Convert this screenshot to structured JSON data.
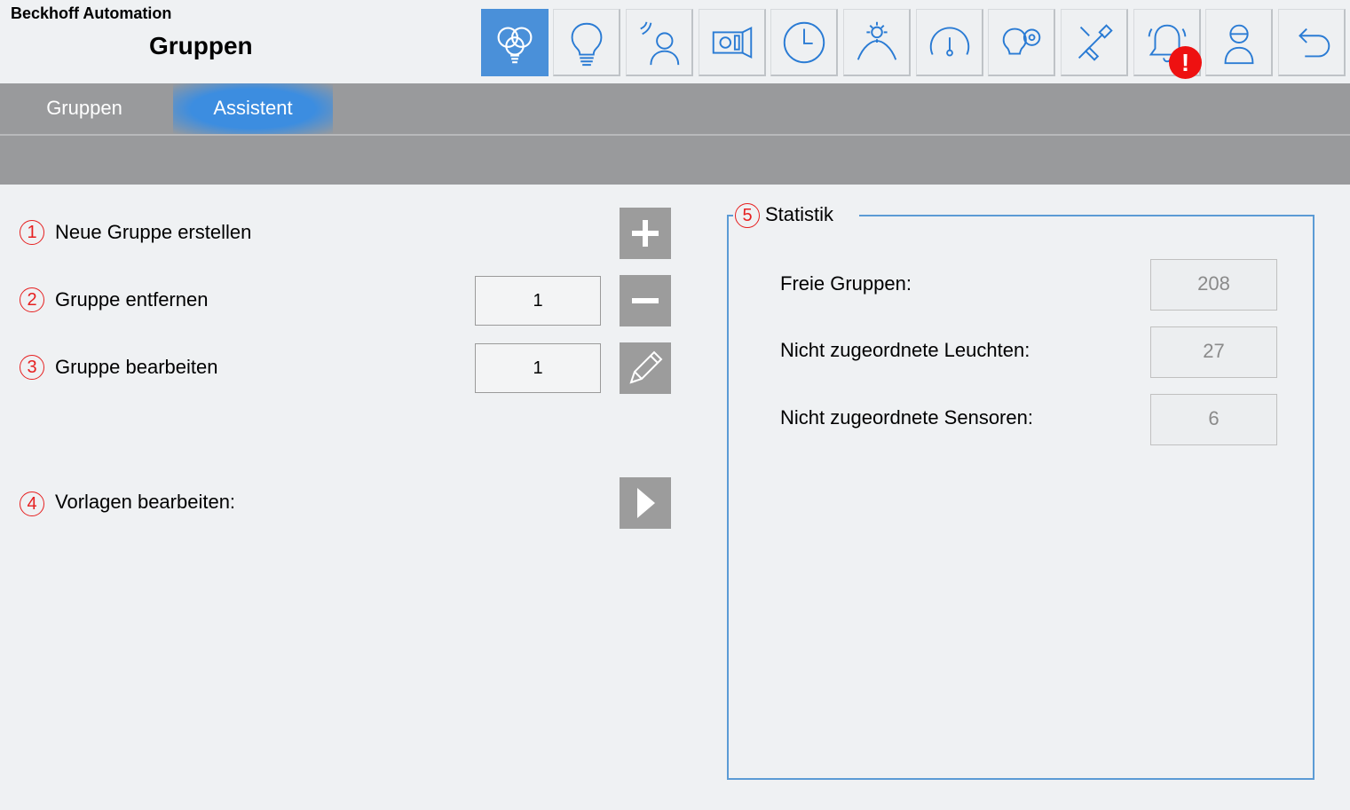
{
  "header": {
    "brand": "Beckhoff Automation",
    "title": "Gruppen"
  },
  "nav": {
    "buttons": [
      {
        "icon": "groups-icon",
        "active": true
      },
      {
        "icon": "bulb-icon"
      },
      {
        "icon": "sensor-person-icon"
      },
      {
        "icon": "device-icon"
      },
      {
        "icon": "clock-icon"
      },
      {
        "icon": "daylight-icon"
      },
      {
        "icon": "gauge-icon"
      },
      {
        "icon": "bulb-gear-icon"
      },
      {
        "icon": "tools-icon"
      },
      {
        "icon": "alarm-bell-icon",
        "badge": "!"
      },
      {
        "icon": "user-icon"
      },
      {
        "icon": "back-icon"
      }
    ],
    "alarm_badge": "!"
  },
  "tabs": [
    {
      "label": "Gruppen",
      "active": false
    },
    {
      "label": "Assistent",
      "active": true
    }
  ],
  "assistant": {
    "rows": [
      {
        "number": "1",
        "label": "Neue Gruppe erstellen",
        "button_icon": "plus-icon"
      },
      {
        "number": "2",
        "label": "Gruppe entfernen",
        "value": "1",
        "button_icon": "minus-icon"
      },
      {
        "number": "3",
        "label": "Gruppe bearbeiten",
        "value": "1",
        "button_icon": "pencil-icon"
      },
      {
        "number": "4",
        "label": "Vorlagen bearbeiten:",
        "button_icon": "play-arrow-icon"
      }
    ]
  },
  "statistics": {
    "number": "5",
    "title": "Statistik",
    "items": [
      {
        "label": "Freie Gruppen:",
        "value": "208"
      },
      {
        "label": "Nicht zugeordnete Leuchten:",
        "value": "27"
      },
      {
        "label": "Nicht zugeordnete Sensoren:",
        "value": "6"
      }
    ]
  },
  "colors": {
    "accent": "#4a90d9",
    "tabbar": "#999a9c",
    "marker": "#e62020",
    "frame": "#5b9bd5",
    "alarm": "#ee1111"
  }
}
